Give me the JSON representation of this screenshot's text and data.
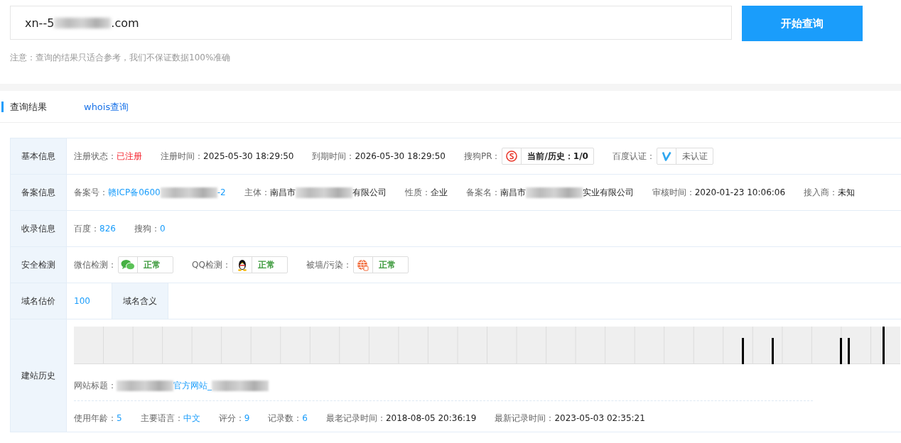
{
  "search": {
    "value": [
      {
        "text": "xn--5"
      },
      {
        "blurred": true
      },
      {
        "text": ".com"
      }
    ],
    "button": "开始查询",
    "notice": "注意：查询的结果只适合参考，我们不保证数据100%准确"
  },
  "tabs": [
    {
      "label": "查询结果",
      "selected": true
    },
    {
      "label": "whois查询",
      "selected": false
    }
  ],
  "rows": [
    {
      "label": "基本信息",
      "items": [
        {
          "kind": "pair",
          "key": "注册状态：",
          "value": [
            {
              "text": "已注册"
            }
          ],
          "color": "#f5222d"
        },
        {
          "kind": "pair",
          "key": "注册时间：",
          "value": [
            {
              "text": "2025-05-30 18:29:50"
            }
          ],
          "color": "#222222"
        },
        {
          "kind": "pair",
          "key": "到期时间：",
          "value": [
            {
              "text": "2026-05-30 18:29:50"
            }
          ],
          "color": "#222222"
        },
        {
          "kind": "sogou",
          "key": "搜狗PR：",
          "text": "当前/历史：1/0",
          "color": "#222222"
        },
        {
          "kind": "verify",
          "key": "百度认证：",
          "text": "未认证",
          "color": "#666666"
        }
      ]
    },
    {
      "label": "备案信息",
      "items": [
        {
          "kind": "pair",
          "key": "备案号：",
          "value": [
            {
              "text": "赣ICP备0600"
            },
            {
              "blurred": true
            },
            {
              "text": "-2"
            }
          ],
          "color": "#1a9dfb"
        },
        {
          "kind": "pair",
          "key": "主体：",
          "value": [
            {
              "text": "南昌市"
            },
            {
              "blurred": true
            },
            {
              "text": "有限公司"
            }
          ]
        },
        {
          "kind": "pair",
          "key": "性质：",
          "value": [
            {
              "text": "企业"
            }
          ]
        },
        {
          "kind": "pair",
          "key": "备案名：",
          "value": [
            {
              "text": "南昌市"
            },
            {
              "blurred": true
            },
            {
              "text": "实业有限公司"
            }
          ]
        },
        {
          "kind": "pair",
          "key": "审核时间：",
          "value": [
            {
              "text": "2020-01-23 10:06:06"
            }
          ],
          "color": "#222222"
        },
        {
          "kind": "pair",
          "key": "接入商：",
          "value": [
            {
              "text": "未知"
            }
          ],
          "color": "#222222"
        }
      ]
    },
    {
      "label": "收录信息",
      "items": [
        {
          "kind": "pair",
          "key": "百度：",
          "value": [
            {
              "text": "826"
            }
          ],
          "color": "#1a9dfb"
        },
        {
          "kind": "pair",
          "key": "搜狗：",
          "value": [
            {
              "text": "0"
            }
          ],
          "color": "#1a9dfb"
        }
      ]
    },
    {
      "label": "安全检测",
      "items": [
        {
          "kind": "wechat",
          "key": "微信检测：",
          "text": "正常",
          "color": "#3c9a3c"
        },
        {
          "kind": "penguin",
          "key": "QQ检测：",
          "text": "正常",
          "color": "#3c9a3c"
        },
        {
          "kind": "globe",
          "key": "被墙/污染：",
          "text": "正常",
          "color": "#3c9a3c"
        }
      ]
    },
    {
      "label": "域名估价",
      "items": [
        {
          "kind": "value",
          "value": [
            {
              "text": "100"
            }
          ],
          "color": "#1a9dfb"
        },
        {
          "kind": "subhead",
          "text": "域名含义"
        }
      ]
    },
    {
      "label": "建站历史",
      "items": [
        {
          "kind": "timeline"
        },
        {
          "kind": "link",
          "key": "网站标题：",
          "value": [
            {
              "blurred": true
            },
            {
              "text": "官方网站_"
            },
            {
              "blurred": true
            }
          ]
        },
        {
          "kind": "stats",
          "pairs": [
            {
              "key": "使用年龄：",
              "value": "5",
              "color": "#1a9dfb"
            },
            {
              "key": "主要语言：",
              "value": "中文",
              "color": "#1a9dfb"
            },
            {
              "key": "评分：",
              "value": "9",
              "color": "#1a9dfb"
            },
            {
              "key": "记录数：",
              "value": "6",
              "color": "#1a9dfb"
            },
            {
              "key": "最老记录时间：",
              "value": "2018-08-05 20:36:19",
              "color": "#222222"
            },
            {
              "key": "最新记录时间：",
              "value": "2023-05-03 02:35:21",
              "color": "#222222"
            }
          ]
        }
      ]
    }
  ]
}
